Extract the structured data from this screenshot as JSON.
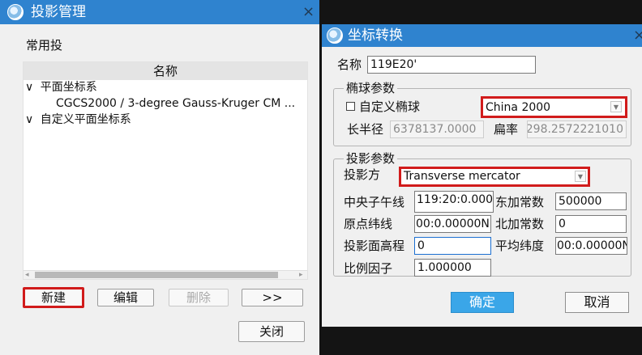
{
  "projection_manager": {
    "title": "投影管理",
    "close_glyph": "×",
    "section_label": "常用投",
    "list_header": "名称",
    "tree": [
      {
        "label": "平面坐标系",
        "expanded": true,
        "children": [
          "CGCS2000 / 3-degree Gauss-Kruger CM ..."
        ]
      },
      {
        "label": "自定义平面坐标系",
        "expanded": true,
        "children": []
      }
    ],
    "buttons": {
      "new": "新建",
      "edit": "编辑",
      "delete": "删除",
      "more": ">>",
      "close": "关闭"
    }
  },
  "coordinate_transform": {
    "title": "坐标转换",
    "close_glyph": "×",
    "name_label": "名称",
    "name_value": "119E20'",
    "ellipsoid": {
      "legend": "椭球参数",
      "custom_label": "自定义椭球",
      "custom_checked": false,
      "selected": "China 2000",
      "semi_major_label": "长半径",
      "semi_major_value": "6378137.0000",
      "flattening_label": "扁率",
      "flattening_value": "298.2572221010"
    },
    "projection": {
      "legend": "投影参数",
      "method_label": "投影方",
      "method_value": "Transverse mercator",
      "central_meridian_label": "中央子午线",
      "central_meridian_value": "119:20:0.000",
      "false_easting_label": "东加常数",
      "false_easting_value": "500000",
      "origin_lat_label": "原点纬线",
      "origin_lat_value": "00:0.00000N",
      "false_northing_label": "北加常数",
      "false_northing_value": "0",
      "proj_height_label": "投影面高程",
      "proj_height_value": "0",
      "mean_lat_label": "平均纬度",
      "mean_lat_value": "00:0.00000N",
      "scale_label": "比例因子",
      "scale_value": "1.000000"
    },
    "buttons": {
      "ok": "确定",
      "cancel": "取消"
    }
  },
  "colors": {
    "titlebar": "#2f83cf",
    "highlight": "#d11b1b",
    "primary": "#3aa6e8"
  }
}
